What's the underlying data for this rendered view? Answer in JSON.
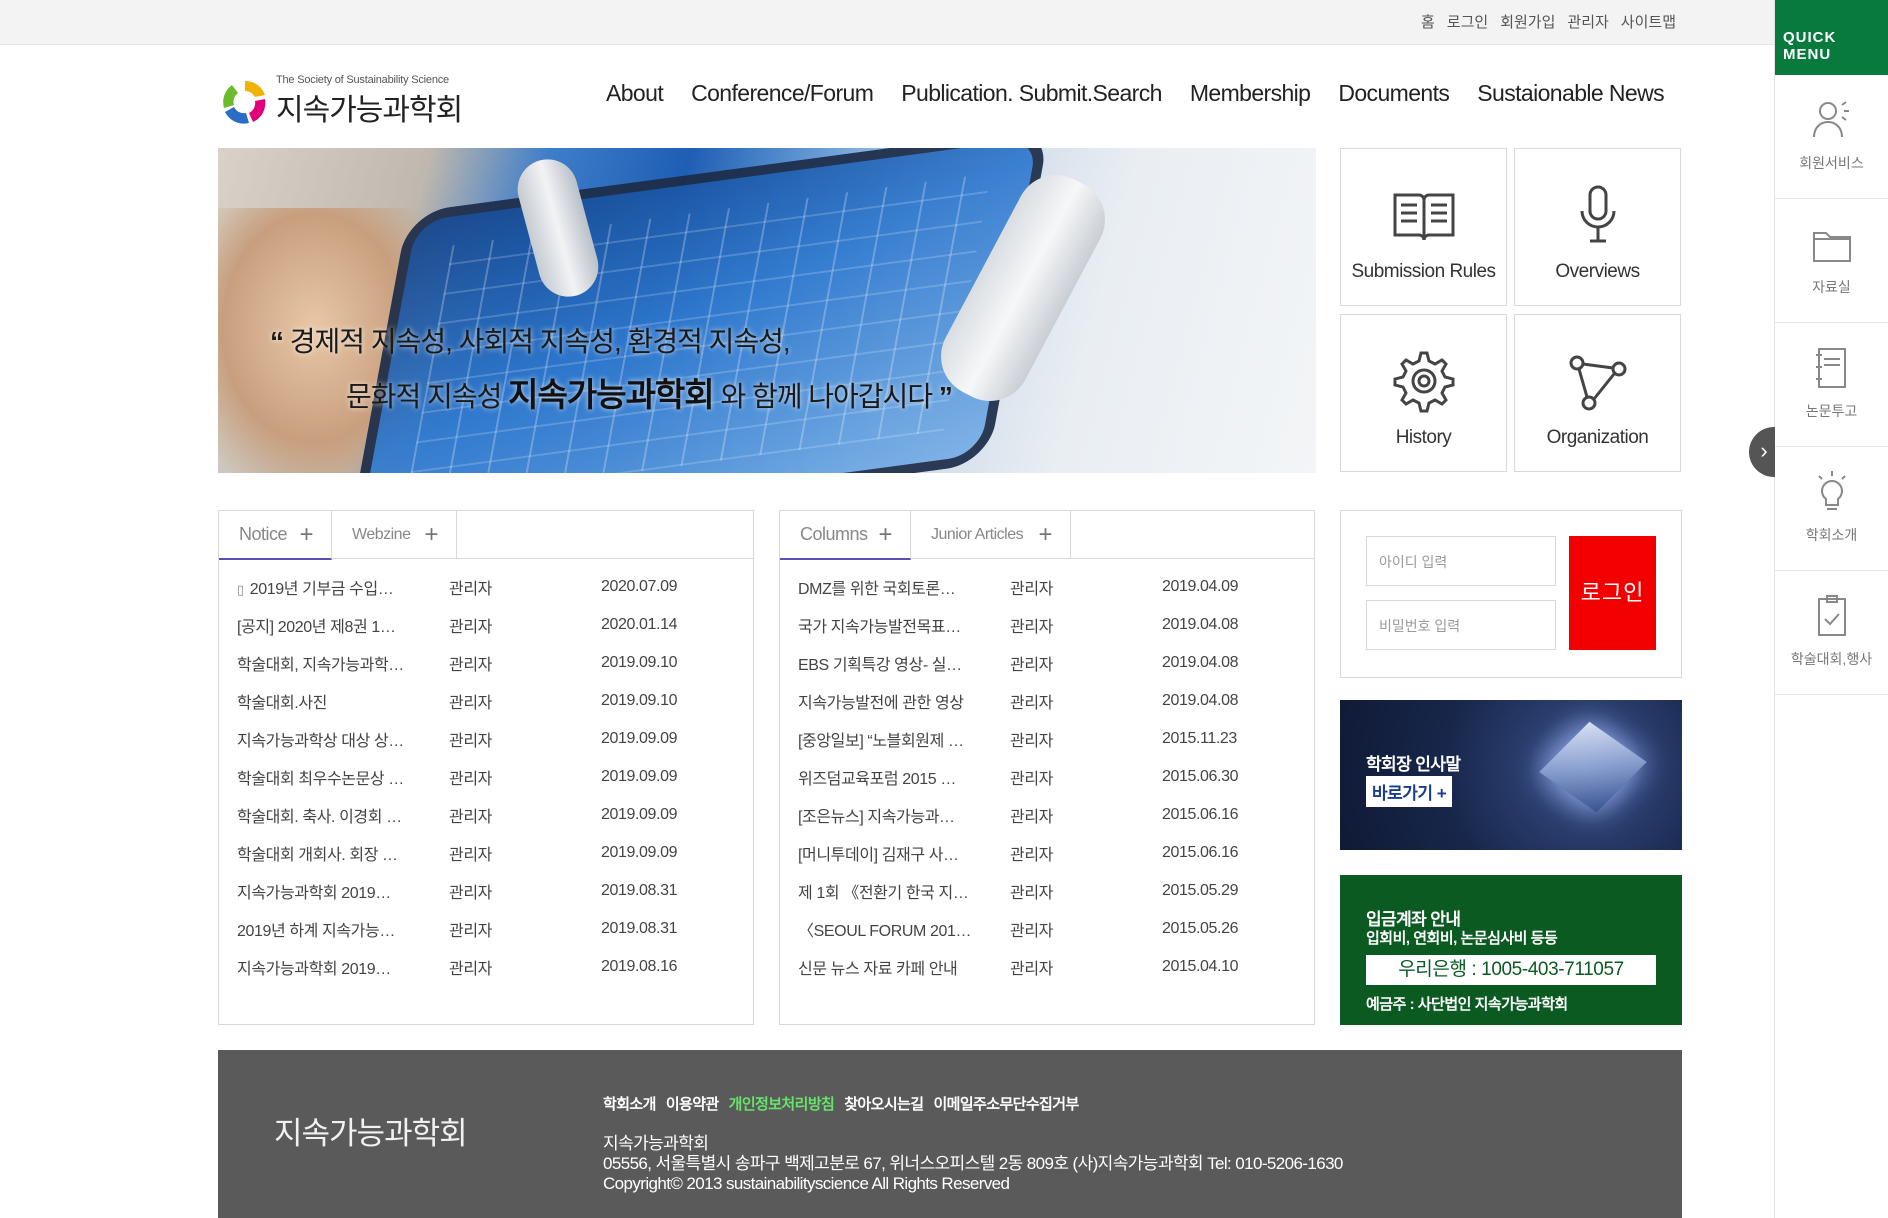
{
  "util_links": [
    "홈",
    "로그인",
    "회원가입",
    "관리자",
    "사이트맵"
  ],
  "quick_menu": {
    "title": "QUICK MENU",
    "items": [
      {
        "label": "회원서비스",
        "icon": "member-service-icon"
      },
      {
        "label": "자료실",
        "icon": "folder-icon"
      },
      {
        "label": "논문투고",
        "icon": "notebook-icon"
      },
      {
        "label": "학회소개",
        "icon": "lightbulb-icon"
      },
      {
        "label": "학술대회,행사",
        "icon": "clipboard-check-icon"
      }
    ],
    "toggle": "›"
  },
  "logo": {
    "sub": "The Society of Sustainability Science",
    "main": "지속가능과학회"
  },
  "nav": [
    "About",
    "Conference/Forum",
    "Publication. Submit.Search",
    "Membership",
    "Documents",
    "Sustaionable News"
  ],
  "banner": {
    "line1": "경제적 지속성, 사회적 지속성, 환경적 지속성,",
    "line2_pre": "문화적 지속성",
    "line2_bold": "지속가능과학회",
    "line2_post": "와 함께 나아갑시다",
    "open_quote": "“",
    "close_quote": "”"
  },
  "tiles": [
    {
      "label": "Submission Rules",
      "icon": "book-icon"
    },
    {
      "label": "Overviews",
      "icon": "microphone-icon"
    },
    {
      "label": "History",
      "icon": "gear-icon"
    },
    {
      "label": "Organization",
      "icon": "network-icon"
    }
  ],
  "board_left": {
    "tabs": [
      {
        "label": "Notice",
        "plus": "+"
      },
      {
        "label": "Webzine",
        "plus": "+"
      }
    ],
    "rows": [
      {
        "title": "2019년 기부금 수입…",
        "author": "관리자",
        "date": "2020.07.09",
        "mobile": "▯"
      },
      {
        "title": "[공지] 2020년 제8권 1…",
        "author": "관리자",
        "date": "2020.01.14"
      },
      {
        "title": "학술대회, 지속가능과학…",
        "author": "관리자",
        "date": "2019.09.10"
      },
      {
        "title": "학술대회.사진",
        "author": "관리자",
        "date": "2019.09.10"
      },
      {
        "title": "지속가능과학상 대상 상…",
        "author": "관리자",
        "date": "2019.09.09"
      },
      {
        "title": "학술대회 최우수논문상 …",
        "author": "관리자",
        "date": "2019.09.09"
      },
      {
        "title": "학술대회. 축사. 이경회 …",
        "author": "관리자",
        "date": "2019.09.09"
      },
      {
        "title": "학술대회 개회사. 회장 …",
        "author": "관리자",
        "date": "2019.09.09"
      },
      {
        "title": "지속가능과학회 2019…",
        "author": "관리자",
        "date": "2019.08.31"
      },
      {
        "title": "2019년 하계 지속가능…",
        "author": "관리자",
        "date": "2019.08.31"
      },
      {
        "title": "지속가능과학회 2019…",
        "author": "관리자",
        "date": "2019.08.16"
      }
    ]
  },
  "board_right": {
    "tabs": [
      {
        "label": "Columns",
        "plus": "+"
      },
      {
        "label": "Junior Articles",
        "plus": "+"
      }
    ],
    "rows": [
      {
        "title": "DMZ를 위한 국회토론…",
        "author": "관리자",
        "date": "2019.04.09"
      },
      {
        "title": "국가 지속가능발전목표…",
        "author": "관리자",
        "date": "2019.04.08"
      },
      {
        "title": "EBS 기획특강 영상- 실…",
        "author": "관리자",
        "date": "2019.04.08"
      },
      {
        "title": "지속가능발전에 관한 영상",
        "author": "관리자",
        "date": "2019.04.08"
      },
      {
        "title": "[중앙일보] “노블회원제 …",
        "author": "관리자",
        "date": "2015.11.23"
      },
      {
        "title": "위즈덤교육포럼 2015 …",
        "author": "관리자",
        "date": "2015.06.30"
      },
      {
        "title": "[조은뉴스] 지속가능과…",
        "author": "관리자",
        "date": "2015.06.16"
      },
      {
        "title": "[머니투데이] 김재구 사…",
        "author": "관리자",
        "date": "2015.06.16"
      },
      {
        "title": "제 1회 《전환기 한국 지…",
        "author": "관리자",
        "date": "2015.05.29"
      },
      {
        "title": "〈SEOUL FORUM 201…",
        "author": "관리자",
        "date": "2015.05.26"
      },
      {
        "title": "신문 뉴스 자료 카페 안내",
        "author": "관리자",
        "date": "2015.04.10"
      }
    ]
  },
  "login": {
    "id_placeholder": "아이디 입력",
    "pw_placeholder": "비밀번호 입력",
    "button": "로그인"
  },
  "greeting": {
    "title": "학회장 인사말",
    "button": "바로가기 +"
  },
  "account": {
    "title": "입금계좌 안내",
    "subtitle": "입회비, 연회비, 논문심사비 등등",
    "bank": "우리은행 : 1005-403-711057",
    "holder": "예금주 : 사단법인 지속가능과학회"
  },
  "footer": {
    "name": "지속가능과학회",
    "links": [
      "학회소개",
      "이용약관",
      "개인정보처리방침",
      "찾아오시는길",
      "이메일주소무단수집거부"
    ],
    "org": "지속가능과학회",
    "address": "05556, 서울특별시 송파구 백제고분로 67, 위너스오피스텔 2동 809호 (사)지속가능과학회  Tel: 010-5206-1630",
    "copyright": "Copyright© 2013 sustainabilityscience All Rights Reserved"
  },
  "colors": {
    "quick_header": "#087a3e",
    "login_button": "#f20000",
    "account_bg": "#0b5a22",
    "footer_bg": "#5a5a5a",
    "privacy_link": "#66e36a",
    "tab_active": "#5a4fb5"
  }
}
